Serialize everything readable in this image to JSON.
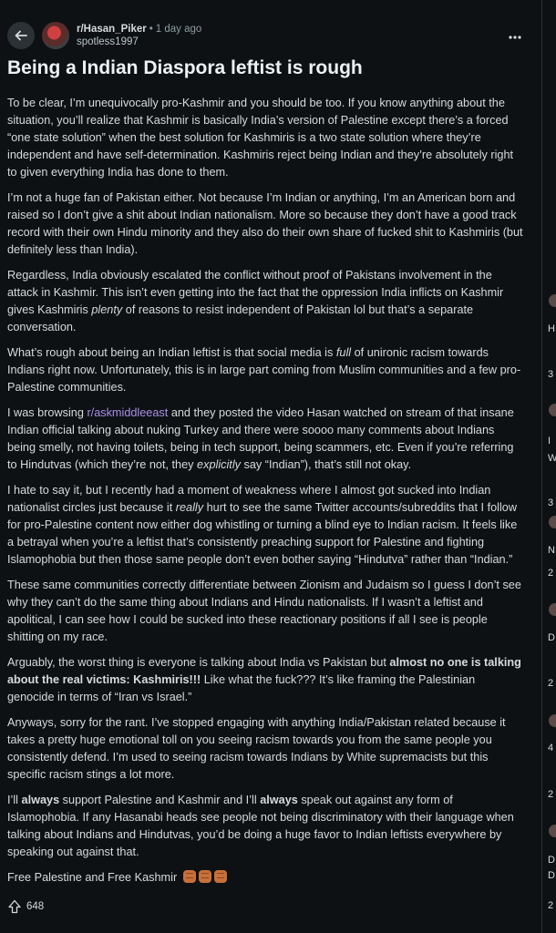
{
  "post": {
    "subreddit": "r/Hasan_Piker",
    "separator": "•",
    "time": "1 day ago",
    "author": "spotless1997",
    "title": "Being a Indian Diaspora leftist is rough",
    "upvotes": "648",
    "paragraphs": {
      "p1": "To be clear, I’m unequivocally pro-Kashmir and you should be too. If you know anything about the situation, you’ll realize that Kashmir is basically India’s version of Palestine except there’s a forced “one state solution” when the best solution for Kashmiris is a two state solution where they’re independent and have self-determination. Kashmiris reject being Indian and they’re absolutely right to given everything India has done to them.",
      "p2": "I’m not a huge fan of Pakistan either. Not because I’m Indian or anything, I’m an American born and raised so I don’t give a shit about Indian nationalism. More so because they don’t have a good track record with their own Hindu minority and they also do their own share of fucked shit to Kashmiris (but definitely less than India).",
      "p3a": "Regardless, India obviously escalated the conflict without proof of Pakistans involvement in the attack in Kashmir. This isn’t even getting into the fact that the oppression India inflicts on Kashmir gives Kashmiris ",
      "p3em": "plenty",
      "p3b": " of reasons to resist independent of Pakistan lol but that’s a separate conversation.",
      "p4a": "What’s rough about being an Indian leftist is that social media is ",
      "p4em": "full",
      "p4b": " of unironic racism towards Indians right now. Unfortunately, this is in large part coming from Muslim communities and a few pro-Palestine communities.",
      "p5a": "I was browsing ",
      "p5link": "r/askmiddleeast",
      "p5b": " and they posted the video Hasan watched on stream of that insane Indian official talking about nuking Turkey and there were soooo many comments about Indians being smelly, not having toilets, being in tech support, being scammers, etc. Even if you’re referring to Hindutvas (which they’re not, they ",
      "p5em": "explicitly",
      "p5c": " say “Indian”), that’s still not okay.",
      "p6a": "I hate to say it, but I recently had a moment of weakness where I almost got sucked into Indian nationalist circles just because it ",
      "p6em": "really",
      "p6b": " hurt to see the same Twitter accounts/subreddits that I follow for pro-Palestine content now either dog whistling or turning a blind eye to Indian racism. It feels like a betrayal when you’re a leftist that’s consistently preaching support for Palestine and fighting Islamophobia but then those same people don’t even bother saying “Hindutva” rather than “Indian.”",
      "p7": "These same communities correctly differentiate between Zionism and Judaism so I guess I don’t see why they can’t do the same thing about Indians and Hindu nationalists. If I wasn’t a leftist and apolitical, I can see how I could be sucked into these reactionary positions if all I see is people shitting on my race.",
      "p8a": "Arguably, the worst thing is everyone is talking about India vs Pakistan but ",
      "p8strong": "almost no one is talking about the real victims: Kashmiris!!!",
      "p8b": " Like what the fuck??? It’s like framing the Palestinian genocide in terms of “Iran vs Israel.”",
      "p9": "Anyways, sorry for the rant. I’ve stopped engaging with anything India/Pakistan related because it takes a pretty huge emotional toll on you seeing racism towards you from the same people you consistently defend. I’m used to seeing racism towards Indians by White supremacists but this specific racism stings a lot more.",
      "p10a": "I’ll ",
      "p10s1": "always",
      "p10b": " support Palestine and Kashmir and I’ll ",
      "p10s2": "always",
      "p10c": " speak out against any form of Islamophobia. If any Hasanabi heads see people not being discriminatory with their language when talking about Indians and Hindutvas, you’d be doing a huge favor to Indian leftists everywhere by speaking out against that.",
      "p11": "Free Palestine and Free Kashmir"
    }
  },
  "sidebar": {
    "fragments": [
      "H",
      "3",
      "I",
      "W",
      "3",
      "N",
      "2",
      "D",
      "2",
      "4",
      "2",
      "D",
      "D",
      "2"
    ]
  },
  "colors": {
    "background": "#0e1113",
    "text": "#d7dadc",
    "link": "#a98ee8",
    "muted": "#8b9a9f"
  },
  "icons": {
    "back": "arrow-left-icon",
    "more": "more-dots-icon",
    "upvote": "upvote-arrow-icon",
    "emoji": "raised-fist-icon"
  }
}
